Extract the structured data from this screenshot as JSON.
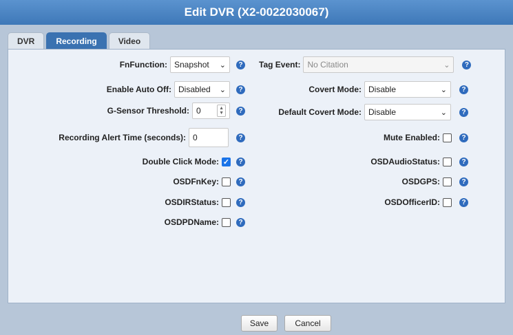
{
  "dialog": {
    "title": "Edit DVR (X2-0022030067)"
  },
  "tabs": [
    {
      "label": "DVR",
      "active": false
    },
    {
      "label": "Recording",
      "active": true
    },
    {
      "label": "Video",
      "active": false
    }
  ],
  "help_glyph": "?",
  "left": {
    "fnfunction": {
      "label": "FnFunction:",
      "value": "Snapshot"
    },
    "auto_off": {
      "label": "Enable Auto Off:",
      "value": "Disabled"
    },
    "gsensor": {
      "label": "G-Sensor Threshold:",
      "value": "0"
    },
    "alert_time": {
      "label": "Recording Alert Time (seconds):",
      "value": "0"
    },
    "double_click": {
      "label": "Double Click Mode:",
      "checked": true
    },
    "osdfnkey": {
      "label": "OSDFnKey:",
      "checked": false
    },
    "osdirstatus": {
      "label": "OSDIRStatus:",
      "checked": false
    },
    "osdpdname": {
      "label": "OSDPDName:",
      "checked": false
    }
  },
  "right": {
    "tag_event": {
      "label": "Tag Event:",
      "value": "No Citation"
    },
    "covert_mode": {
      "label": "Covert Mode:",
      "value": "Disable"
    },
    "default_covert": {
      "label": "Default Covert Mode:",
      "value": "Disable"
    },
    "mute_enabled": {
      "label": "Mute Enabled:",
      "checked": false
    },
    "osdaudiostatus": {
      "label": "OSDAudioStatus:",
      "checked": false
    },
    "osdgps": {
      "label": "OSDGPS:",
      "checked": false
    },
    "osdofficerid": {
      "label": "OSDOfficerID:",
      "checked": false
    }
  },
  "footer": {
    "save_label": "Save",
    "cancel_label": "Cancel"
  },
  "colors": {
    "title_bar": "#3e78b8",
    "active_tab": "#3a72b1",
    "panel_bg": "#ecf1f8",
    "dialog_bg": "#b7c6d8"
  }
}
